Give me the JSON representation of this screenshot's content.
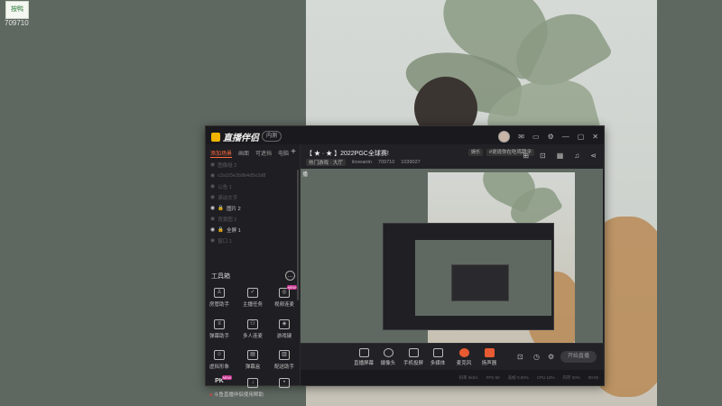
{
  "desktop": {
    "corner_logo_text": "按鸭",
    "corner_number": "709710"
  },
  "window": {
    "brand": "直播伴侣",
    "brand_chip": "内测",
    "title_controls": [
      "✉",
      "▭",
      "⚙",
      "—",
      "▢",
      "✕"
    ]
  },
  "left_panel": {
    "tabs": [
      "添加场景",
      "画面",
      "可遮挡",
      "电脑"
    ],
    "add_label": "+",
    "scenes": [
      {
        "label": "图像投 2",
        "lit": false
      },
      {
        "label": "c2a1f3e2b9b4d5e3d8",
        "lit": false
      },
      {
        "label": "公告 1",
        "lit": false
      },
      {
        "label": "滚动文字",
        "lit": false
      },
      {
        "label": "图片 2",
        "lit": true
      },
      {
        "label": "背景图 2",
        "lit": false
      },
      {
        "label": "全屏 1",
        "lit": true
      },
      {
        "label": "窗口 1",
        "lit": false
      }
    ],
    "tools_header": "工具箱",
    "tools": [
      {
        "label": "房管助手",
        "icon": "person-icon"
      },
      {
        "label": "主播任务",
        "icon": "task-icon"
      },
      {
        "label": "视频连麦",
        "icon": "video-call-icon",
        "badge": "NEW"
      },
      {
        "label": "弹幕助手",
        "icon": "danmaku-icon"
      },
      {
        "label": "多人连麦",
        "icon": "group-icon"
      },
      {
        "label": "游戏键",
        "icon": "game-icon"
      },
      {
        "label": "虚拟形象",
        "icon": "avatar-icon"
      },
      {
        "label": "弹幕盒",
        "icon": "box-icon"
      },
      {
        "label": "配送助手",
        "icon": "assistant-icon"
      },
      {
        "label": "PK",
        "icon": "pk-icon",
        "badge": "NEW"
      },
      {
        "label": "",
        "icon": "download-icon"
      },
      {
        "label": "",
        "icon": "more-icon"
      }
    ],
    "warning": "斗鱼直播伴侣使用帮助"
  },
  "header": {
    "stream_title": "【 ★ · ★ 】2022PGC全球赛!",
    "category_tag": "娱乐",
    "tagline": "#说说你在吃鸡跳伞",
    "meta_area": "热门游戏 · 大厅",
    "meta_user": "iloveantn",
    "meta_id": "709710",
    "meta_hot": "1039027"
  },
  "preview": {
    "mini_icon": "播"
  },
  "toolbar": {
    "buttons": [
      "直播屏幕",
      "摄像头",
      "手机投屏",
      "多媒体",
      "麦克风",
      "扬声器"
    ],
    "start_button": "开始直播"
  },
  "status_bar": [
    "码率 0kb/s",
    "FPS 60",
    "丢帧 0.00%",
    "CPU 10%",
    "内存 20%",
    "00:00"
  ]
}
